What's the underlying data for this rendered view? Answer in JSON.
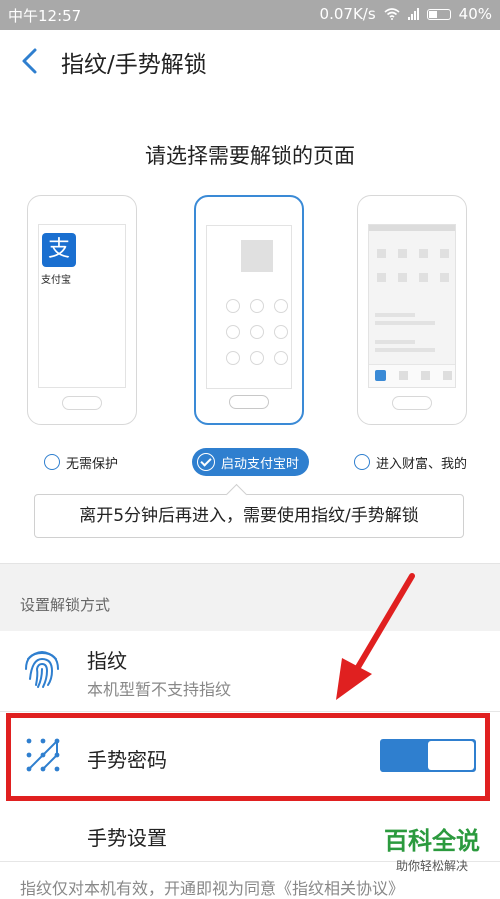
{
  "status_bar": {
    "time": "中午12:57",
    "network_speed": "0.07K/s",
    "battery": "40%"
  },
  "header": {
    "title": "指纹/手势解锁",
    "back_icon": "chevron-left-icon"
  },
  "selection": {
    "subtitle": "请选择需要解锁的页面",
    "alipay_logo_char": "支",
    "alipay_name": "支付宝",
    "options": [
      {
        "label": "无需保护",
        "selected": false
      },
      {
        "label": "启动支付宝时",
        "selected": true
      },
      {
        "label": "进入财富、我的",
        "selected": false
      }
    ],
    "tooltip": "离开5分钟后再进入，需要使用指纹/手势解锁"
  },
  "unlock_methods": {
    "section_label": "设置解锁方式",
    "fingerprint": {
      "title": "指纹",
      "subtitle": "本机型暂不支持指纹",
      "icon": "fingerprint-icon"
    },
    "gesture": {
      "title": "手势密码",
      "icon": "gesture-pattern-icon",
      "enabled": true
    },
    "gesture_settings": {
      "title": "手势设置"
    }
  },
  "footer_text": "指纹仅对本机有效，开通即视为同意《指纹相关协议》",
  "watermark": {
    "title": "百科全说",
    "subtitle": "助你轻松解决"
  },
  "colors": {
    "accent": "#2f7fcf",
    "highlight": "#e02020",
    "status_bar": "#a9a9a9"
  }
}
